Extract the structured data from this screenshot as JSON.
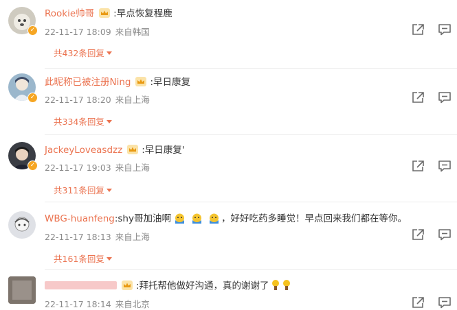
{
  "comments": [
    {
      "username": "Rookie帅哥",
      "text": ":早点恢复程鹿",
      "date": "22-11-17 18:09",
      "location": "来自韩国",
      "replies": "共432条回复",
      "avatar_color": "#cfcbc0"
    },
    {
      "username": "此昵称已被注册Ning",
      "text": ":早日康复",
      "date": "22-11-17 18:20",
      "location": "来自上海",
      "replies": "共334条回复",
      "avatar_color": "#9bb7cc"
    },
    {
      "username": "JackeyLoveasdzz",
      "text": ":早日康复'",
      "date": "22-11-17 19:03",
      "location": "来自上海",
      "replies": "共311条回复",
      "avatar_color": "#3a3d44"
    },
    {
      "username": "WBG-huanfeng",
      "text_a": ":shy哥加油啊",
      "text_b": "，好好吃药多睡觉！早点回来我们都在等你。",
      "date": "22-11-17 18:13",
      "location": "来自上海",
      "replies": "共161条回复",
      "avatar_color": "#dfe1e6"
    },
    {
      "text": ":拜托帮他做好沟通，真的谢谢了",
      "date": "22-11-17 18:14",
      "location": "来自北京",
      "avatar_color": "#6a625c"
    }
  ],
  "colors": {
    "username": "#eb7350",
    "meta": "#8b8b8b",
    "badge": "#f6a623"
  },
  "icons": [
    "share-icon",
    "comment-icon",
    "crown-badge-icon",
    "verified-badge-icon"
  ]
}
